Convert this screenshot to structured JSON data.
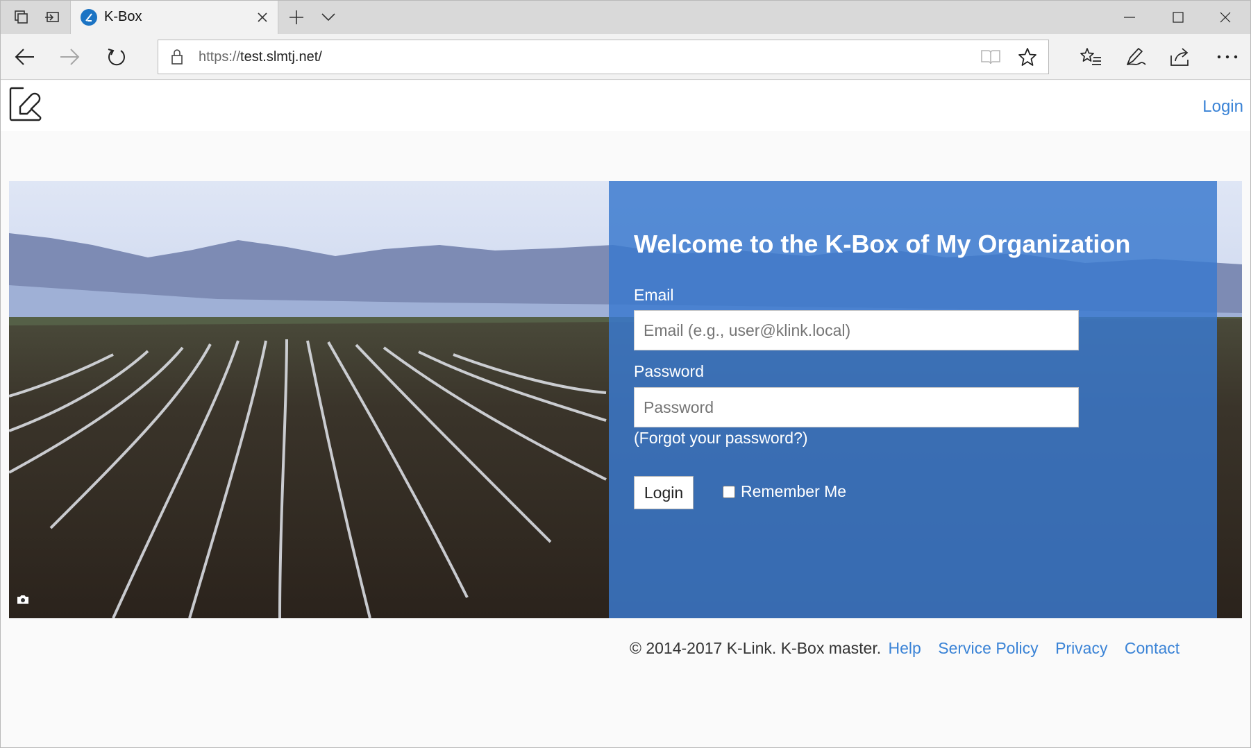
{
  "browser": {
    "tab_title": "K-Box",
    "url_protocol": "https://",
    "url_host": "test.slmtj.net/"
  },
  "header": {
    "login_label": "Login"
  },
  "login_panel": {
    "heading": "Welcome to the K-Box of My Organization",
    "email_label": "Email",
    "email_placeholder": "Email (e.g., user@klink.local)",
    "email_value": "",
    "password_label": "Password",
    "password_placeholder": "Password",
    "password_value": "",
    "forgot_label": "(Forgot your password?)",
    "login_button": "Login",
    "remember_label": "Remember Me",
    "remember_checked": false
  },
  "footer": {
    "copyright": "© 2014-2017 K-Link. K-Box master.",
    "links": [
      "Help",
      "Service Policy",
      "Privacy",
      "Contact"
    ]
  },
  "colors": {
    "accent": "#3a83d6",
    "panel": "#3a7ace",
    "chrome": "#f2f2f2"
  },
  "icons": [
    "tab-actions-icon",
    "set-aside-icon",
    "new-tab-icon",
    "tab-list-icon",
    "back-arrow-icon",
    "forward-arrow-icon",
    "refresh-icon",
    "lock-icon",
    "reading-view-icon",
    "favorite-star-icon",
    "favorites-hub-icon",
    "pen-notes-icon",
    "share-icon",
    "more-icon",
    "camera-icon"
  ]
}
